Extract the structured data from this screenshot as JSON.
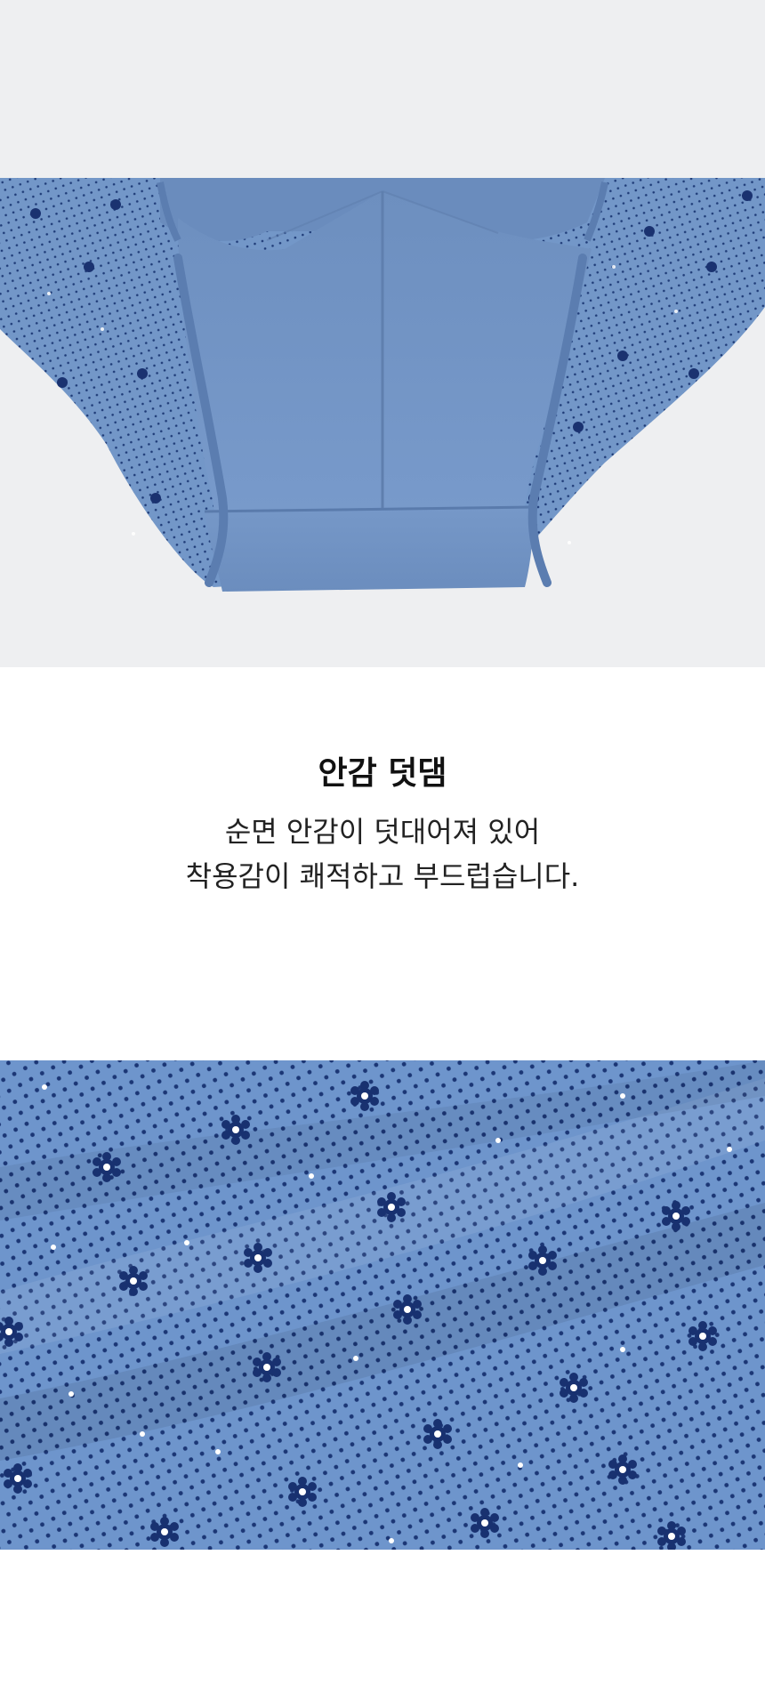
{
  "section": {
    "heading": "안감 덧댐",
    "description_line1": "순면 안감이 덧대어져 있어",
    "description_line2": "착용감이 쾌적하고 부드럽습니다."
  },
  "images": {
    "top_photo": "underwear-crotch-lining-photo",
    "bottom_photo": "fabric-pattern-closeup-photo"
  },
  "colors": {
    "fabric_blue": "#6f93c6",
    "pattern_navy": "#1d3a78",
    "background": "#eeeff1"
  }
}
